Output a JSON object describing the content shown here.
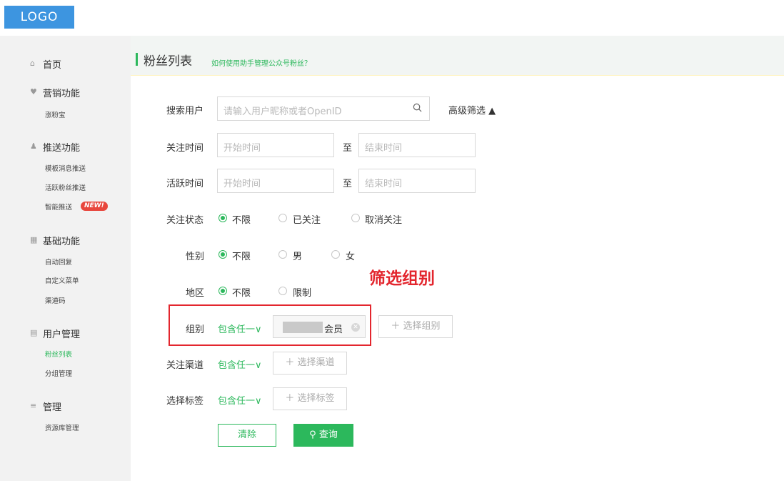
{
  "logo": {
    "text": "LOGO"
  },
  "sidebar": {
    "home": "首页",
    "marketing": {
      "label": "营销功能",
      "items": [
        "涨粉宝"
      ]
    },
    "push": {
      "label": "推送功能",
      "items": [
        "模板消息推送",
        "活跃粉丝推送",
        "智能推送"
      ],
      "new_badge": "NEW!"
    },
    "basic": {
      "label": "基础功能",
      "items": [
        "自动回复",
        "自定义菜单",
        "渠道码"
      ]
    },
    "users": {
      "label": "用户管理",
      "items": [
        "粉丝列表",
        "分组管理"
      ]
    },
    "manage": {
      "label": "管理",
      "items": [
        "资源库管理"
      ]
    }
  },
  "header": {
    "title": "粉丝列表",
    "help_link": "如何使用助手管理公众号粉丝？"
  },
  "form": {
    "search": {
      "label": "搜索用户",
      "placeholder": "请输入用户昵称或者OpenID",
      "advanced": "高级筛选 ▲"
    },
    "follow_time": {
      "label": "关注时间",
      "start": "开始时间",
      "sep": "至",
      "end": "结束时间"
    },
    "active_time": {
      "label": "活跃时间",
      "start": "开始时间",
      "sep": "至",
      "end": "结束时间"
    },
    "follow_status": {
      "label": "关注状态",
      "options": [
        "不限",
        "已关注",
        "取消关注"
      ]
    },
    "gender": {
      "label": "性别",
      "options": [
        "不限",
        "男",
        "女"
      ]
    },
    "region": {
      "label": "地区",
      "options": [
        "不限",
        "限制"
      ]
    },
    "group": {
      "label": "组别",
      "match": "包含任一∨",
      "tag": "会员",
      "select": "＋ 选择组别"
    },
    "channel": {
      "label": "关注渠道",
      "match": "包含任一∨",
      "select": "＋ 选择渠道"
    },
    "tags": {
      "label": "选择标签",
      "match": "包含任一∨",
      "select": "＋ 选择标签"
    },
    "clear": "清除",
    "query": "查询"
  },
  "annotation": {
    "text": "筛选组别"
  },
  "colors": {
    "primary": "#2cb85c",
    "annotation": "#e3262e",
    "logo": "#3d95e0"
  }
}
